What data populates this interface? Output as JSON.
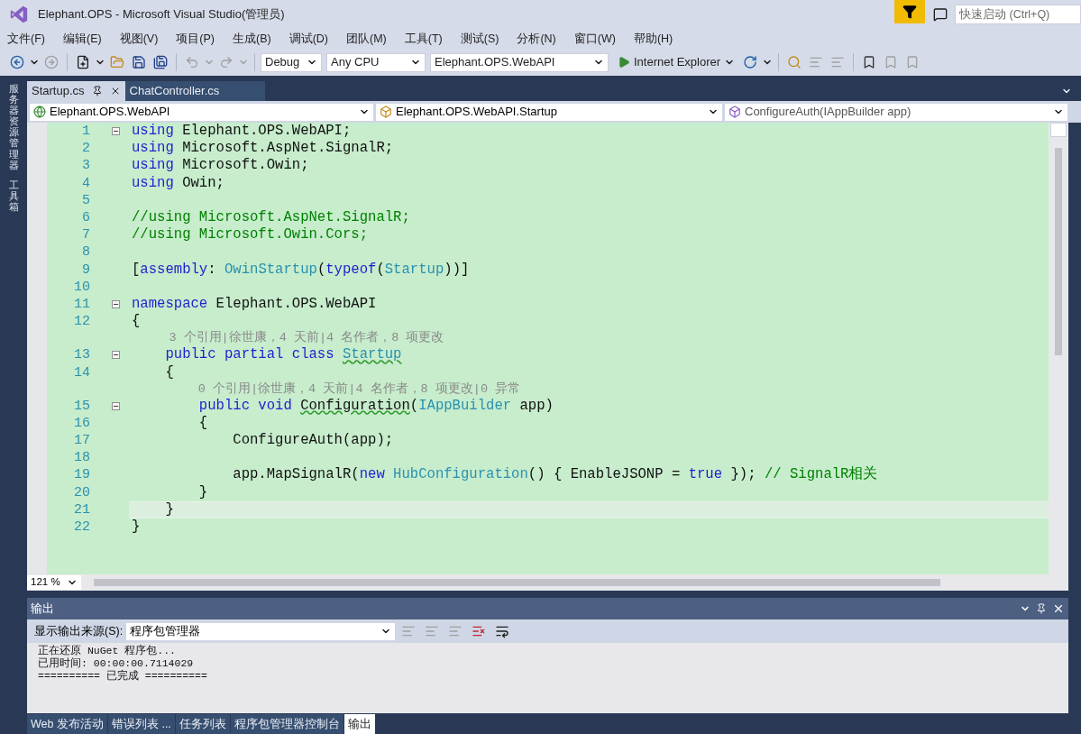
{
  "window": {
    "title": "Elephant.OPS - Microsoft Visual Studio(管理员)",
    "quick_launch": {
      "placeholder": "快速启动 (Ctrl+Q)"
    }
  },
  "menu": [
    "文件(F)",
    "编辑(E)",
    "视图(V)",
    "项目(P)",
    "生成(B)",
    "调试(D)",
    "团队(M)",
    "工具(T)",
    "测试(S)",
    "分析(N)",
    "窗口(W)",
    "帮助(H)"
  ],
  "toolbar": {
    "configuration": "Debug",
    "platform": "Any CPU",
    "startup_project": "Elephant.OPS.WebAPI",
    "run_target": "Internet Explorer"
  },
  "side_tabs": [
    "服务器资源管理器",
    "工具箱"
  ],
  "document_tabs": [
    {
      "label": "Startup.cs",
      "selected": true
    },
    {
      "label": "ChatController.cs",
      "selected": false
    }
  ],
  "navigation": {
    "project": "Elephant.OPS.WebAPI",
    "type": "Elephant.OPS.WebAPI.Startup",
    "member": "ConfigureAuth(IAppBuilder app)"
  },
  "code": [
    {
      "kind": "code",
      "number": "1",
      "fold": true,
      "current": false,
      "tokens": [
        {
          "kind": "keyword",
          "text": "using"
        },
        {
          "kind": "plain",
          "text": " Elephant.OPS.WebAPI;"
        }
      ]
    },
    {
      "kind": "code",
      "number": "2",
      "fold": false,
      "current": false,
      "tokens": [
        {
          "kind": "keyword",
          "text": "using"
        },
        {
          "kind": "plain",
          "text": " Microsoft.AspNet.SignalR;"
        }
      ]
    },
    {
      "kind": "code",
      "number": "3",
      "fold": false,
      "current": false,
      "tokens": [
        {
          "kind": "keyword",
          "text": "using"
        },
        {
          "kind": "plain",
          "text": " Microsoft.Owin;"
        }
      ]
    },
    {
      "kind": "code",
      "number": "4",
      "fold": false,
      "current": false,
      "tokens": [
        {
          "kind": "keyword",
          "text": "using"
        },
        {
          "kind": "plain",
          "text": " Owin;"
        }
      ]
    },
    {
      "kind": "code",
      "number": "5",
      "fold": false,
      "current": false
    },
    {
      "kind": "code",
      "number": "6",
      "fold": false,
      "current": false,
      "tokens": [
        {
          "kind": "comment",
          "text": "//using Microsoft.AspNet.SignalR;"
        }
      ]
    },
    {
      "kind": "code",
      "number": "7",
      "fold": false,
      "current": false,
      "tokens": [
        {
          "kind": "comment",
          "text": "//using Microsoft.Owin.Cors;"
        }
      ]
    },
    {
      "kind": "code",
      "number": "8",
      "fold": false,
      "current": false
    },
    {
      "kind": "code",
      "number": "9",
      "fold": false,
      "current": false,
      "tokens": [
        {
          "kind": "plain",
          "text": "["
        },
        {
          "kind": "keyword",
          "text": "assembly"
        },
        {
          "kind": "plain",
          "text": ": "
        },
        {
          "kind": "type",
          "text": "OwinStartup"
        },
        {
          "kind": "plain",
          "text": "("
        },
        {
          "kind": "keyword",
          "text": "typeof"
        },
        {
          "kind": "plain",
          "text": "("
        },
        {
          "kind": "type",
          "text": "Startup"
        },
        {
          "kind": "plain",
          "text": "))]"
        }
      ]
    },
    {
      "kind": "code",
      "number": "10",
      "fold": false,
      "current": false
    },
    {
      "kind": "code",
      "number": "11",
      "fold": true,
      "current": false,
      "tokens": [
        {
          "kind": "keyword",
          "text": "namespace"
        },
        {
          "kind": "plain",
          "text": " Elephant.OPS.WebAPI"
        }
      ]
    },
    {
      "kind": "code",
      "number": "12",
      "fold": false,
      "current": false,
      "tokens": [
        {
          "kind": "plain",
          "text": "{"
        }
      ]
    },
    {
      "kind": "codelens",
      "text": "    3 个引用|徐世康，4 天前|4 名作者，8 项更改"
    },
    {
      "kind": "code",
      "number": "13",
      "fold": true,
      "current": false,
      "tokens": [
        {
          "kind": "keyword",
          "text": "    public partial class "
        },
        {
          "kind": "type_flagged",
          "text": "Startup"
        }
      ]
    },
    {
      "kind": "code",
      "number": "14",
      "fold": false,
      "current": false,
      "tokens": [
        {
          "kind": "plain",
          "text": "    {"
        }
      ]
    },
    {
      "kind": "codelens",
      "text": "        0 个引用|徐世康，4 天前|4 名作者，8 项更改|0 异常"
    },
    {
      "kind": "code",
      "number": "15",
      "fold": true,
      "current": false,
      "tokens": [
        {
          "kind": "keyword",
          "text": "        public void "
        },
        {
          "kind": "plain_flagged",
          "text": "Configuration"
        },
        {
          "kind": "plain",
          "text": "("
        },
        {
          "kind": "type",
          "text": "IAppBuilder"
        },
        {
          "kind": "plain",
          "text": " app)"
        }
      ]
    },
    {
      "kind": "code",
      "number": "16",
      "fold": false,
      "current": false,
      "tokens": [
        {
          "kind": "plain",
          "text": "        {"
        }
      ]
    },
    {
      "kind": "code",
      "number": "17",
      "fold": false,
      "current": false,
      "tokens": [
        {
          "kind": "plain",
          "text": "            ConfigureAuth(app);"
        }
      ]
    },
    {
      "kind": "code",
      "number": "18",
      "fold": false,
      "current": false
    },
    {
      "kind": "code",
      "number": "19",
      "fold": false,
      "current": false,
      "tokens": [
        {
          "kind": "plain",
          "text": "            app.MapSignalR("
        },
        {
          "kind": "keyword",
          "text": "new "
        },
        {
          "kind": "type",
          "text": "HubConfiguration"
        },
        {
          "kind": "plain",
          "text": "() { EnableJSONP = "
        },
        {
          "kind": "keyword",
          "text": "true"
        },
        {
          "kind": "plain",
          "text": " }); "
        },
        {
          "kind": "comment",
          "text": "// SignalR相关"
        }
      ]
    },
    {
      "kind": "code",
      "number": "20",
      "fold": false,
      "current": false,
      "tokens": [
        {
          "kind": "plain",
          "text": "        }"
        }
      ]
    },
    {
      "kind": "code",
      "number": "21",
      "fold": false,
      "current": true,
      "tokens": [
        {
          "kind": "plain",
          "text": "    }"
        }
      ]
    },
    {
      "kind": "code",
      "number": "22",
      "fold": false,
      "current": false,
      "tokens": [
        {
          "kind": "plain",
          "text": "}"
        }
      ]
    }
  ],
  "zoom": "121 %",
  "output": {
    "title": "输出",
    "source_label": "显示输出来源(S):",
    "source": "程序包管理器",
    "lines": [
      "正在还原 NuGet 程序包...",
      "已用时间: 00:00:00.7114029",
      "========== 已完成 =========="
    ]
  },
  "bottom_tabs": [
    {
      "label": "Web 发布活动",
      "selected": false
    },
    {
      "label": "错误列表 ...",
      "selected": false
    },
    {
      "label": "任务列表",
      "selected": false
    },
    {
      "label": "程序包管理器控制台",
      "selected": false
    },
    {
      "label": "输出",
      "selected": true
    }
  ]
}
